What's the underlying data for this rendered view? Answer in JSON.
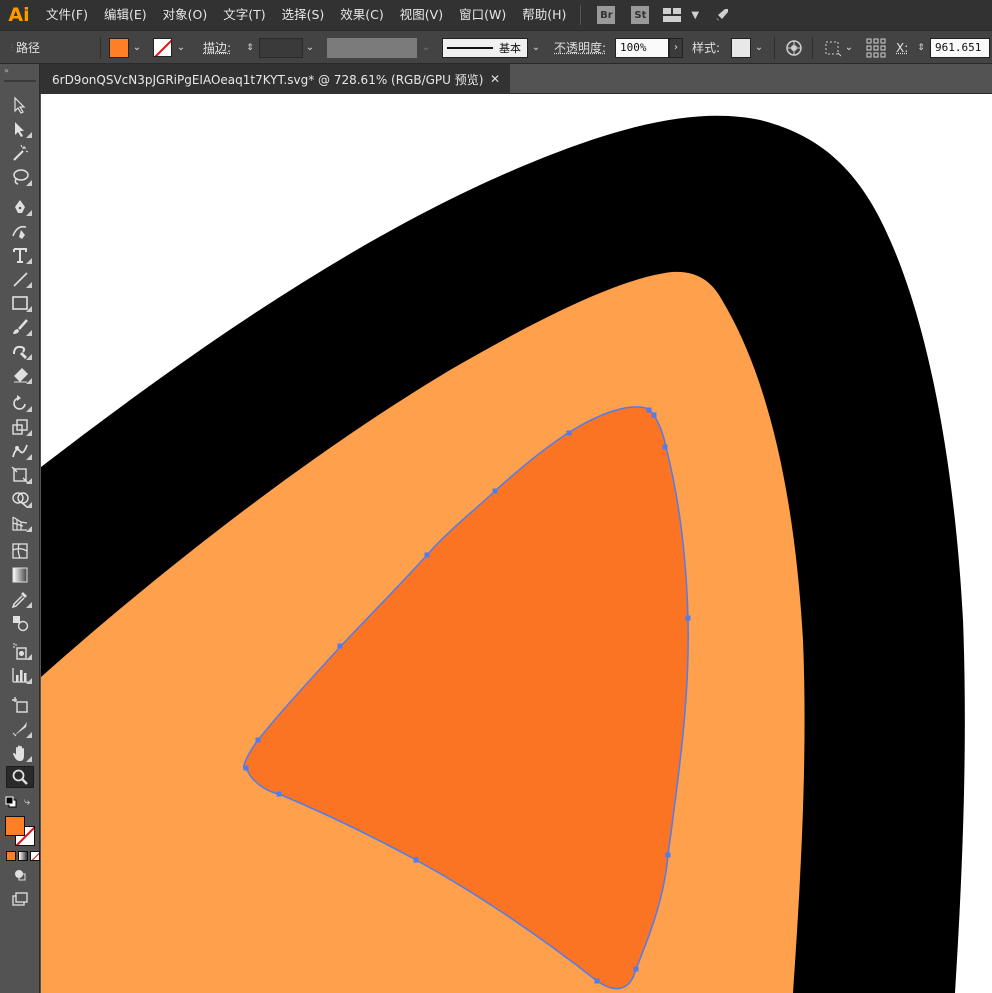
{
  "app": {
    "logo": "Ai"
  },
  "menu": [
    {
      "label": "文件(F)"
    },
    {
      "label": "编辑(E)"
    },
    {
      "label": "对象(O)"
    },
    {
      "label": "文字(T)"
    },
    {
      "label": "选择(S)"
    },
    {
      "label": "效果(C)"
    },
    {
      "label": "视图(V)"
    },
    {
      "label": "窗口(W)"
    },
    {
      "label": "帮助(H)"
    }
  ],
  "menu_icons": {
    "bridge": "Br",
    "stock": "St",
    "layout_icon": "workspace-layout-icon",
    "gpu_icon": "rocket-icon"
  },
  "control": {
    "object_type": "路径",
    "fill_color": "#ff7f27",
    "stroke_label": "描边",
    "stroke_colon": ":",
    "brush_label": "基本",
    "opacity_label": "不透明度",
    "opacity_colon": ":",
    "opacity_value": "100%",
    "style_label": "样式",
    "style_colon": ":",
    "x_label": "X:",
    "x_value": "961.651"
  },
  "document": {
    "tab_label": "6rD9onQSVcN3pJGRiPgEIAOeaq1t7KYT.svg* @ 728.61% (RGB/GPU 预览)",
    "close_glyph": "✕"
  },
  "colors": {
    "outer_shape": "#000000",
    "middle_shape": "#ffa04c",
    "inner_shape": "#fa7423",
    "selection": "#4f7df0"
  },
  "tools": [
    "selection-tool-icon",
    "direct-selection-tool-icon",
    "magic-wand-tool-icon",
    "lasso-tool-icon",
    "pen-tool-icon",
    "curvature-tool-icon",
    "type-tool-icon",
    "line-segment-tool-icon",
    "rectangle-tool-icon",
    "paintbrush-tool-icon",
    "shaper-tool-icon",
    "eraser-tool-icon",
    "rotate-tool-icon",
    "scale-tool-icon",
    "warp-tool-icon",
    "free-transform-tool-icon",
    "shape-builder-tool-icon",
    "perspective-grid-tool-icon",
    "mesh-tool-icon",
    "gradient-tool-icon",
    "eyedropper-tool-icon",
    "blend-tool-icon",
    "symbol-sprayer-tool-icon",
    "column-graph-tool-icon",
    "artboard-tool-icon",
    "slice-tool-icon",
    "hand-tool-icon",
    "zoom-tool-icon"
  ]
}
